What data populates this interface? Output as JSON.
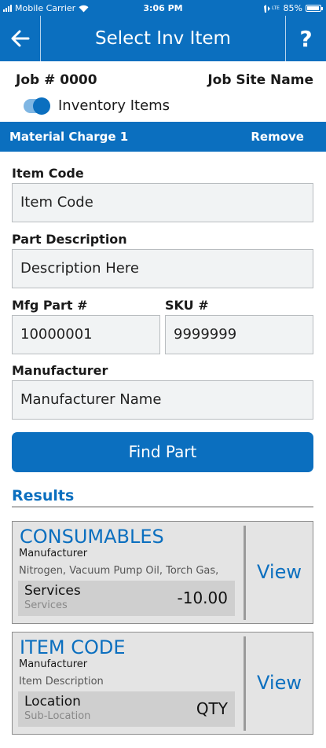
{
  "status": {
    "carrier": "Mobile Carrier",
    "time": "3:06 PM",
    "battery": "85%",
    "battery_level": 0.85
  },
  "nav": {
    "title": "Select Inv Item",
    "help": "?"
  },
  "job": {
    "number": "Job # 0000",
    "site": "Job Site Name"
  },
  "inventory_toggle": {
    "label": "Inventory Items",
    "on": true
  },
  "section": {
    "title": "Material Charge 1",
    "remove": "Remove"
  },
  "form": {
    "item_code_label": "Item Code",
    "item_code_value": "Item Code",
    "part_desc_label": "Part Description",
    "part_desc_value": "Description Here",
    "mfg_part_label": "Mfg Part #",
    "mfg_part_value": "10000001",
    "sku_label": "SKU #",
    "sku_value": "9999999",
    "manufacturer_label": "Manufacturer",
    "manufacturer_value": "Manufacturer Name"
  },
  "find_button": "Find Part",
  "results": {
    "title": "Results",
    "items": [
      {
        "title": "CONSUMABLES",
        "manufacturer": "Manufacturer",
        "description": "Nitrogen, Vacuum Pump Oil, Torch Gas,",
        "location": "Services",
        "sublocation": "Services",
        "value": "-10.00",
        "view": "View"
      },
      {
        "title": "ITEM CODE",
        "manufacturer": "Manufacturer",
        "description": "Item Description",
        "location": "Location",
        "sublocation": "Sub-Location",
        "value": "QTY",
        "view": "View"
      }
    ]
  },
  "colors": {
    "primary": "#0b6fbf",
    "field_bg": "#f1f3f4",
    "card_bg": "#e4e4e4"
  }
}
